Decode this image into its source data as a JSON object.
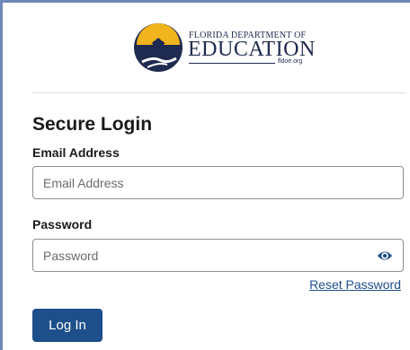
{
  "logo": {
    "top_text": "FLORIDA DEPARTMENT OF",
    "main_text": "EDUCATION",
    "url": "fldoe.org"
  },
  "form": {
    "title": "Secure Login",
    "email_label": "Email Address",
    "email_placeholder": "Email Address",
    "email_value": "",
    "password_label": "Password",
    "password_placeholder": "Password",
    "password_value": "",
    "reset_link": "Reset Password",
    "submit_label": "Log In"
  },
  "colors": {
    "brand_navy": "#1e2a4f",
    "button": "#1d4f8b",
    "link": "#1f4e8c",
    "seal_gold": "#f2b41c"
  },
  "icons": {
    "seal": "florida-seal-icon",
    "password_toggle": "eye-icon"
  }
}
